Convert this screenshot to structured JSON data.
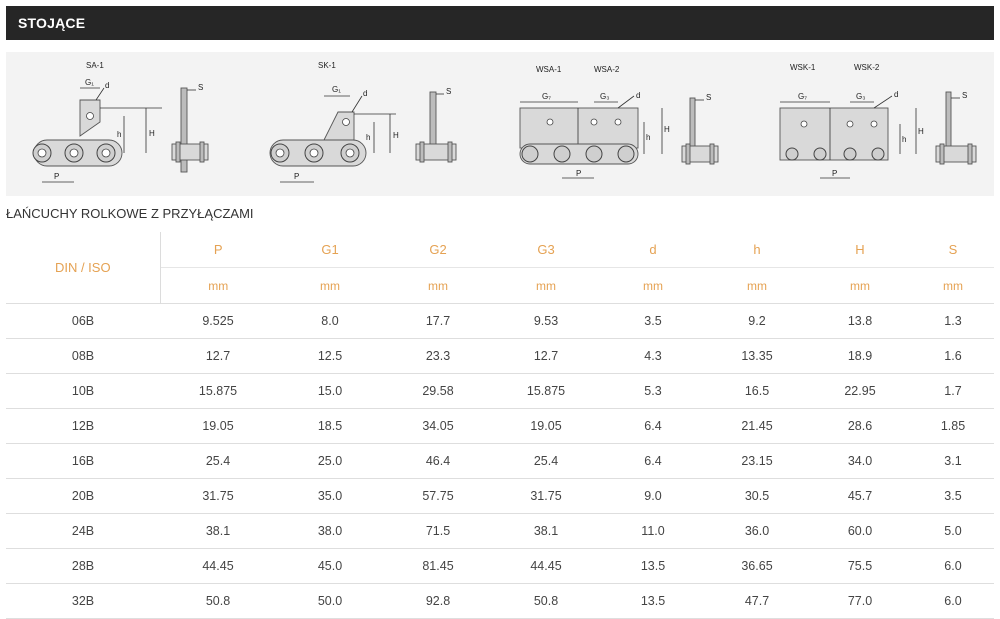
{
  "header": {
    "title": "STOJĄCE"
  },
  "diagrams": {
    "sa": {
      "title": "SA-1",
      "g": "G₁",
      "d": "d",
      "h": "h",
      "H": "H",
      "P": "P",
      "S": "S"
    },
    "sk": {
      "title": "SK-1",
      "g": "G₁",
      "d": "d",
      "h": "h",
      "H": "H",
      "P": "P",
      "S": "S"
    },
    "wsa": {
      "title1": "WSA-1",
      "title2": "WSA-2",
      "g7": "G₇",
      "g3": "G₃",
      "d": "d",
      "h": "h",
      "H": "H",
      "P": "P",
      "S": "S"
    },
    "wsk": {
      "title1": "WSK-1",
      "title2": "WSK-2",
      "g7": "G₇",
      "g3": "G₃",
      "d": "d",
      "h": "h",
      "H": "H",
      "P": "P",
      "S": "S"
    }
  },
  "section_title": "ŁAŃCUCHY ROLKOWE Z PRZYŁĄCZAMI",
  "table": {
    "din_header": "DIN / ISO",
    "columns": [
      "P",
      "G1",
      "G2",
      "G3",
      "d",
      "h",
      "H",
      "S"
    ],
    "units": [
      "mm",
      "mm",
      "mm",
      "mm",
      "mm",
      "mm",
      "mm",
      "mm"
    ],
    "rows": [
      [
        "06B",
        "9.525",
        "8.0",
        "17.7",
        "9.53",
        "3.5",
        "9.2",
        "13.8",
        "1.3"
      ],
      [
        "08B",
        "12.7",
        "12.5",
        "23.3",
        "12.7",
        "4.3",
        "13.35",
        "18.9",
        "1.6"
      ],
      [
        "10B",
        "15.875",
        "15.0",
        "29.58",
        "15.875",
        "5.3",
        "16.5",
        "22.95",
        "1.7"
      ],
      [
        "12B",
        "19.05",
        "18.5",
        "34.05",
        "19.05",
        "6.4",
        "21.45",
        "28.6",
        "1.85"
      ],
      [
        "16B",
        "25.4",
        "25.0",
        "46.4",
        "25.4",
        "6.4",
        "23.15",
        "34.0",
        "3.1"
      ],
      [
        "20B",
        "31.75",
        "35.0",
        "57.75",
        "31.75",
        "9.0",
        "30.5",
        "45.7",
        "3.5"
      ],
      [
        "24B",
        "38.1",
        "38.0",
        "71.5",
        "38.1",
        "11.0",
        "36.0",
        "60.0",
        "5.0"
      ],
      [
        "28B",
        "44.45",
        "45.0",
        "81.45",
        "44.45",
        "13.5",
        "36.65",
        "75.5",
        "6.0"
      ],
      [
        "32B",
        "50.8",
        "50.0",
        "92.8",
        "50.8",
        "13.5",
        "47.7",
        "77.0",
        "6.0"
      ]
    ]
  },
  "colors": {
    "header_bg": "#262626",
    "accent": "#e5a253",
    "diagram_bg": "#f3f3f3"
  }
}
